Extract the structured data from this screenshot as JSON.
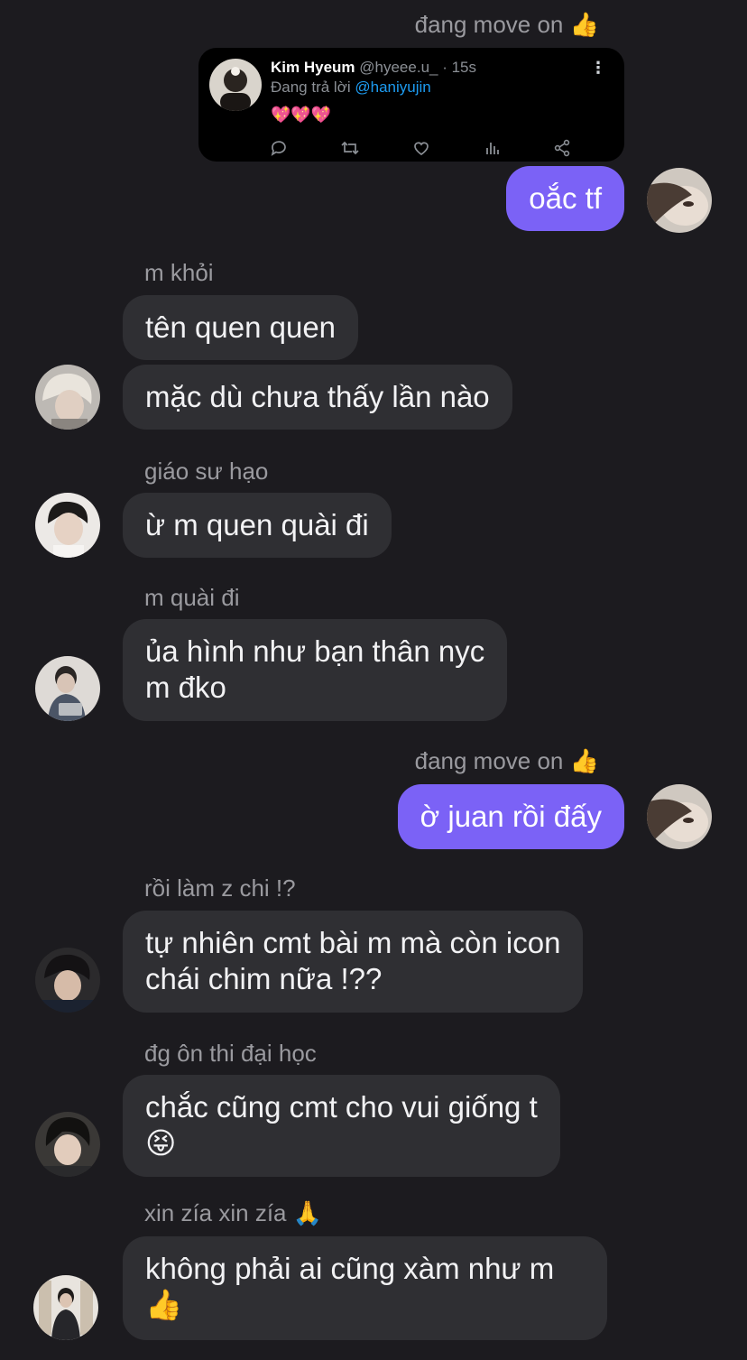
{
  "tweet": {
    "name": "Kim Hyeum",
    "handle": "@hyeee.u_",
    "time": "· 15s",
    "reply_prefix": "Đang trả lời",
    "reply_to": "@haniyujin",
    "hearts": "💖💖💖",
    "more": "⋮",
    "actions": [
      "reply-icon",
      "retweet-icon",
      "like-icon",
      "views-icon",
      "share-icon"
    ]
  },
  "messages": [
    {
      "sender": "đang move on 👍",
      "text": "oắc tf",
      "mine": true
    },
    {
      "sender": "m khỏi",
      "text": "tên quen quen"
    },
    {
      "text": "mặc dù chưa thấy lần nào"
    },
    {
      "sender": "giáo sư hạo",
      "text": "ừ m quen quài đi"
    },
    {
      "sender": "m quài đi",
      "text": "ủa hình như bạn thân nyc\nm đko"
    },
    {
      "sender": "đang move on 👍",
      "text": "ờ juan rồi đấy",
      "mine": true
    },
    {
      "sender": "rồi làm z chi !?",
      "text": "tự nhiên cmt bài m mà còn icon\nchái chim nữa !??"
    },
    {
      "sender": "đg ôn thi đại học",
      "text": "chắc cũng cmt cho vui giống t\n😝"
    },
    {
      "sender": "xin zía xin zía 🙏",
      "text": "không phải ai cũng xàm như m\n👍"
    }
  ],
  "colors": {
    "background": "#1c1b1f",
    "bubble_other": "#2f2f33",
    "bubble_mine": "#7b62f6",
    "sender_text": "#9a9a9f",
    "mention": "#1d9bf0"
  }
}
